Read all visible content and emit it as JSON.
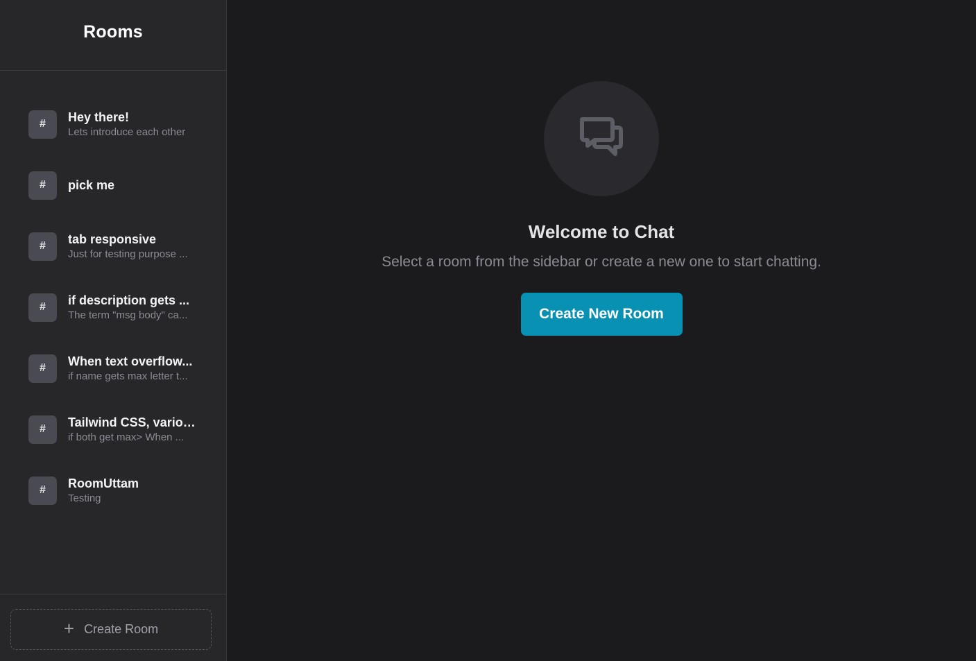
{
  "sidebar": {
    "title": "Rooms",
    "rooms": [
      {
        "icon": "#",
        "name": "Hey there!",
        "description": "Lets introduce each other"
      },
      {
        "icon": "#",
        "name": "pick me",
        "description": ""
      },
      {
        "icon": "#",
        "name": "tab responsive",
        "description": "Just for testing purpose ..."
      },
      {
        "icon": "#",
        "name": "if description gets ...",
        "description": "The term \"msg body\" ca..."
      },
      {
        "icon": "#",
        "name": "When text overflow...",
        "description": "if name gets max letter t..."
      },
      {
        "icon": "#",
        "name": "Tailwind CSS, variou...",
        "description": "if both get max> When ..."
      },
      {
        "icon": "#",
        "name": "RoomUttam",
        "description": "Testing"
      }
    ],
    "create_button": {
      "icon": "plus-icon",
      "label": "Create Room"
    }
  },
  "main": {
    "icon": "chat-bubbles-icon",
    "welcome_title": "Welcome to Chat",
    "welcome_subtitle": "Select a room from the sidebar or create a new one to start chatting.",
    "cta_label": "Create New Room"
  },
  "colors": {
    "accent": "#0891b2",
    "sidebar_bg": "#27272a",
    "main_bg": "#1b1b1e"
  }
}
